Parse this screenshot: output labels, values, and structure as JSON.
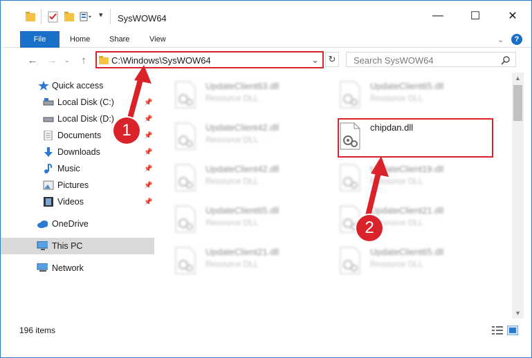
{
  "window": {
    "title": "SysWOW64",
    "controls": {
      "minimize": "—",
      "maximize": "☐",
      "close": "✕"
    }
  },
  "ribbon": {
    "tabs": [
      "File",
      "Home",
      "Share",
      "View"
    ],
    "help": "?",
    "expand": "⌄"
  },
  "nav": {
    "back": "←",
    "forward": "→",
    "dropdown": "⌄",
    "up": "↑",
    "address": "C:\\Windows\\SysWOW64",
    "address_dropdown": "⌄",
    "refresh": "↻",
    "search_placeholder": "Search SysWOW64",
    "search_icon": "⚲"
  },
  "sidebar": {
    "items": [
      {
        "label": "Quick access",
        "icon": "star-icon",
        "pinned": false
      },
      {
        "label": "Local Disk (C:)",
        "icon": "drive-icon",
        "pinned": true
      },
      {
        "label": "Local Disk (D:)",
        "icon": "drive-icon",
        "pinned": true
      },
      {
        "label": "Documents",
        "icon": "documents-icon",
        "pinned": true
      },
      {
        "label": "Downloads",
        "icon": "download-icon",
        "pinned": true
      },
      {
        "label": "Music",
        "icon": "music-icon",
        "pinned": true
      },
      {
        "label": "Pictures",
        "icon": "pictures-icon",
        "pinned": true
      },
      {
        "label": "Videos",
        "icon": "videos-icon",
        "pinned": true
      },
      {
        "label": "OneDrive",
        "icon": "cloud-icon",
        "pinned": false
      },
      {
        "label": "This PC",
        "icon": "computer-icon",
        "pinned": false,
        "selected": true
      },
      {
        "label": "Network",
        "icon": "network-icon",
        "pinned": false
      }
    ],
    "pin_glyph": "📌"
  },
  "files": {
    "left_column": [
      {
        "name": "UpdateClient63.dll",
        "type": "Resource DLL"
      },
      {
        "name": "UpdateClient42.dll",
        "type": "Resource DLL"
      },
      {
        "name": "UpdateClient42.dll",
        "type": "Resource DLL"
      },
      {
        "name": "UpdateClient65.dll",
        "type": "Resource DLL"
      },
      {
        "name": "UpdateClient21.dll",
        "type": "Resource DLL"
      }
    ],
    "right_column": [
      {
        "name": "UpdateClient65.dll",
        "type": "Resource DLL"
      },
      {
        "name": "chipdan.dll",
        "type": ""
      },
      {
        "name": "UpdateClient19.dll",
        "type": "Resource DLL"
      },
      {
        "name": "UpdateClient21.dll",
        "type": "Resource DLL"
      },
      {
        "name": "UpdateClient65.dll",
        "type": "Resource DLL"
      }
    ]
  },
  "status": {
    "item_count": "196 items"
  },
  "annotations": {
    "badge_1": "1",
    "badge_2": "2",
    "color": "#d9222a"
  },
  "colors": {
    "accent": "#1a6fc9",
    "highlight": "#d9222a",
    "selected_bg": "#d9d9d9",
    "folder": "#f4c244"
  }
}
